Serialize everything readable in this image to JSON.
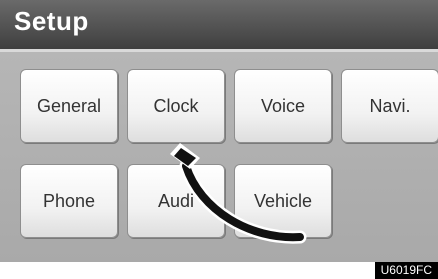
{
  "title": "Setup",
  "buttons": {
    "general": "General",
    "clock": "Clock",
    "voice": "Voice",
    "navi": "Navi.",
    "phone": "Phone",
    "audio": "Audi",
    "vehicle": "Vehicle"
  },
  "figure_code": "U6019FC",
  "icons": {
    "arrow": "curved-arrow-icon"
  }
}
